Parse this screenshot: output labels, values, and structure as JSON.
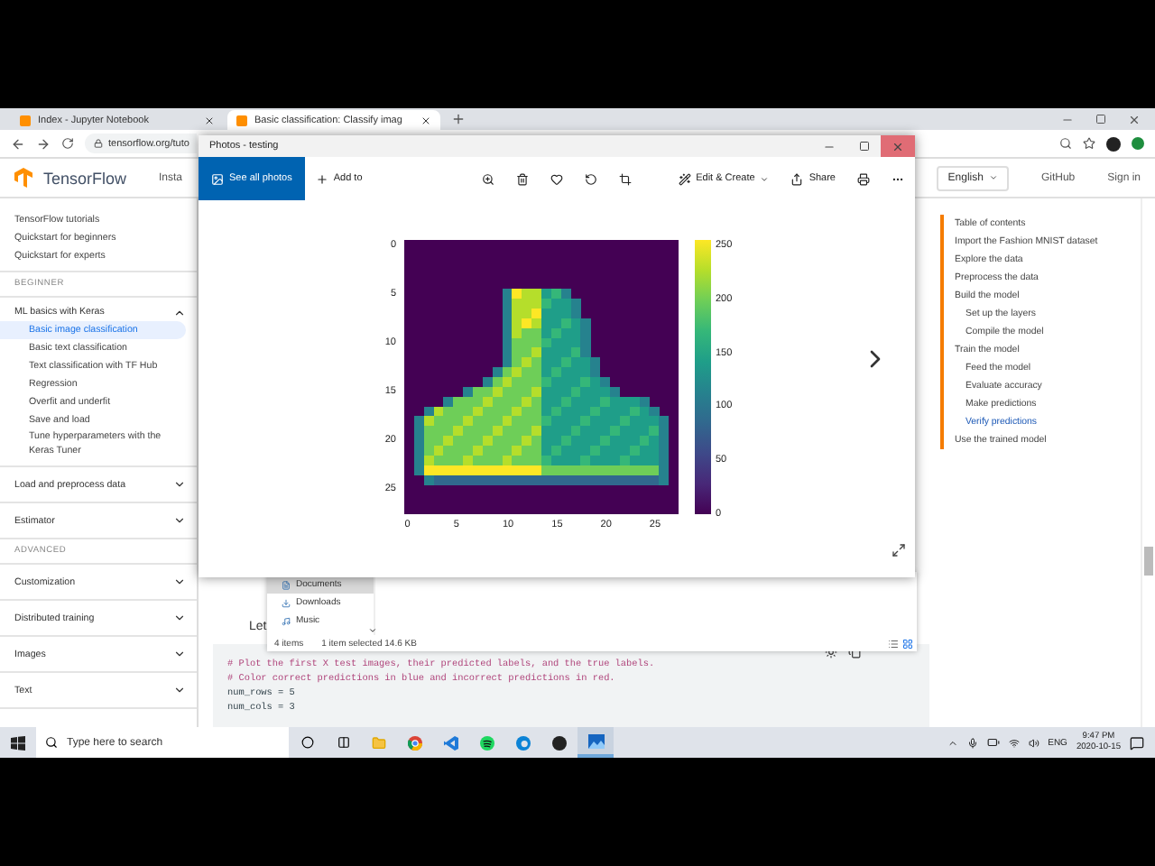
{
  "browser": {
    "tabs": [
      {
        "title": "Index - Jupyter Notebook",
        "selected": false
      },
      {
        "title": "Basic classification: Classify imag",
        "selected": true
      }
    ],
    "address": "tensorflow.org/tuto",
    "site": {
      "logo": "TensorFlow",
      "nav": [
        "Insta"
      ],
      "language": "English",
      "links": [
        "GitHub",
        "Sign in"
      ]
    },
    "sidebar": {
      "sections": [
        {
          "kind": "links",
          "items": [
            {
              "label": "TensorFlow tutorials",
              "selected": false
            },
            {
              "label": "Quickstart for beginners",
              "selected": false
            },
            {
              "label": "Quickstart for experts",
              "selected": false
            }
          ]
        },
        {
          "kind": "heading",
          "label": "BEGINNER"
        },
        {
          "kind": "group",
          "label": "ML basics with Keras",
          "expanded": true,
          "children": [
            {
              "label": "Basic image classification",
              "selected": true
            },
            {
              "label": "Basic text classification",
              "selected": false
            },
            {
              "label": "Text classification with TF Hub",
              "selected": false
            },
            {
              "label": "Regression",
              "selected": false
            },
            {
              "label": "Overfit and underfit",
              "selected": false
            },
            {
              "label": "Save and load",
              "selected": false
            },
            {
              "label": "Tune hyperparameters with the Keras Tuner",
              "selected": false
            }
          ]
        },
        {
          "kind": "group",
          "label": "Load and preprocess data",
          "expanded": false
        },
        {
          "kind": "group",
          "label": "Estimator",
          "expanded": false
        },
        {
          "kind": "heading",
          "label": "ADVANCED"
        },
        {
          "kind": "group",
          "label": "Customization",
          "expanded": false
        },
        {
          "kind": "group",
          "label": "Distributed training",
          "expanded": false
        },
        {
          "kind": "group",
          "label": "Images",
          "expanded": false
        },
        {
          "kind": "group",
          "label": "Text",
          "expanded": false
        }
      ]
    },
    "content": {
      "text": "Let",
      "code": [
        "# Plot the first X test images, their predicted labels, and the true labels.",
        "# Color correct predictions in blue and incorrect predictions in red.",
        "num_rows = 5",
        "num_cols = 3"
      ]
    },
    "toc": {
      "title": "Table of contents",
      "items": [
        {
          "label": "Import the Fashion MNIST dataset",
          "selected": false
        },
        {
          "label": "Explore the data",
          "selected": false
        },
        {
          "label": "Preprocess the data",
          "selected": false
        },
        {
          "label": "Build the model",
          "selected": false,
          "children": [
            {
              "label": "Set up the layers",
              "selected": false
            },
            {
              "label": "Compile the model",
              "selected": false
            }
          ]
        },
        {
          "label": "Train the model",
          "selected": false,
          "children": [
            {
              "label": "Feed the model",
              "selected": false
            },
            {
              "label": "Evaluate accuracy",
              "selected": false
            },
            {
              "label": "Make predictions",
              "selected": false
            },
            {
              "label": "Verify predictions",
              "selected": true
            }
          ]
        },
        {
          "label": "Use the trained model",
          "selected": false
        }
      ]
    }
  },
  "photos_window": {
    "title": "Photos - testing",
    "toolbar": {
      "primary": "See all photos",
      "add": "Add to",
      "edit": "Edit & Create",
      "share": "Share"
    },
    "plot": {
      "yticks": [
        "0",
        "5",
        "10",
        "15",
        "20",
        "25"
      ],
      "xticks": [
        "0",
        "5",
        "10",
        "15",
        "20",
        "25"
      ],
      "colorbar_ticks": [
        "250",
        "200",
        "150",
        "100",
        "50",
        "0"
      ]
    }
  },
  "explorer": {
    "folders": [
      {
        "name": "Documents",
        "selected": true
      },
      {
        "name": "Downloads",
        "selected": false
      },
      {
        "name": "Music",
        "selected": false
      }
    ],
    "status": {
      "count": "4 items",
      "selection": "1 item selected  14.6 KB"
    }
  },
  "taskbar": {
    "search_placeholder": "Type here to search",
    "language": "ENG",
    "time": "9:47 PM",
    "date": "2020-10-15"
  }
}
